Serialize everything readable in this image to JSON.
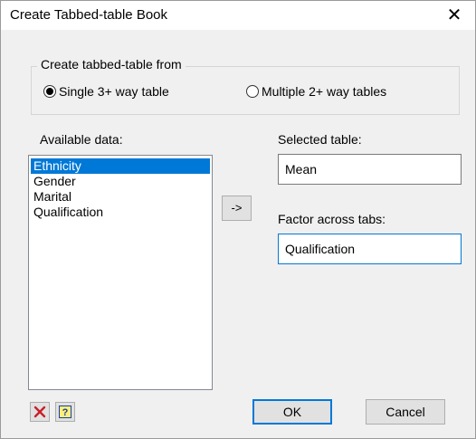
{
  "window": {
    "title": "Create Tabbed-table Book",
    "close_glyph": "✕"
  },
  "create_from": {
    "legend": "Create tabbed-table from",
    "options": [
      {
        "label": "Single 3+ way table",
        "checked": true
      },
      {
        "label": "Multiple 2+ way tables",
        "checked": false
      }
    ]
  },
  "available": {
    "label": "Available data:",
    "items": [
      "Ethnicity",
      "Gender",
      "Marital",
      "Qualification"
    ],
    "selected_index": 0
  },
  "transfer_button": "->",
  "selected_table": {
    "label": "Selected table:",
    "value": "Mean"
  },
  "factor_across_tabs": {
    "label": "Factor across tabs:",
    "value": "Qualification"
  },
  "footer": {
    "clear_icon": "red-x-icon",
    "help_icon": "help-icon",
    "help_glyph": "?",
    "ok_label": "OK",
    "cancel_label": "Cancel"
  },
  "colors": {
    "selection": "#0078d7",
    "clear_icon": "#c8202a",
    "help_icon": "#1a3fa0"
  }
}
